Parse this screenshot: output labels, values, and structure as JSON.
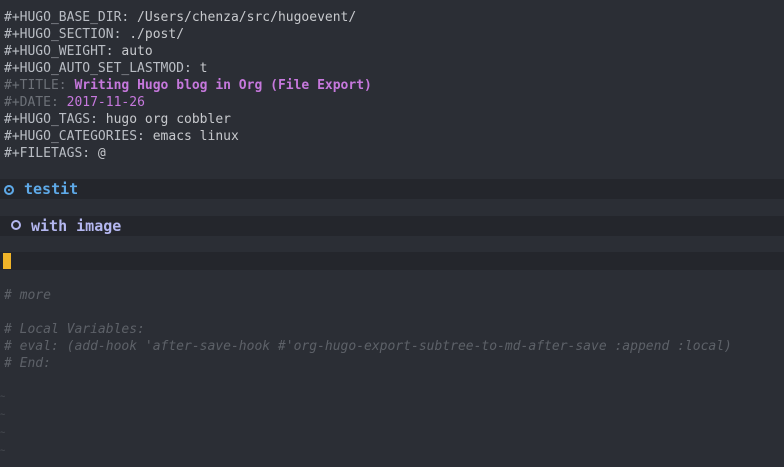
{
  "keywords": [
    {
      "key": "#+HUGO_BASE_DIR:",
      "value": " /Users/chenza/src/hugoevent/"
    },
    {
      "key": "#+HUGO_SECTION:",
      "value": " ./post/"
    },
    {
      "key": "#+HUGO_WEIGHT:",
      "value": " auto"
    },
    {
      "key": "#+HUGO_AUTO_SET_LASTMOD:",
      "value": " t"
    },
    {
      "key": "#+TITLE:",
      "value": " Writing Hugo blog in Org (File Export)"
    },
    {
      "key": "#+DATE:",
      "value": " 2017-11-26"
    },
    {
      "key": "#+HUGO_TAGS:",
      "value": " hugo org cobbler"
    },
    {
      "key": "#+HUGO_CATEGORIES:",
      "value": " emacs linux"
    },
    {
      "key": "#+FILETAGS:",
      "value": " @"
    }
  ],
  "headings": {
    "level1": "testit",
    "level2": "with image"
  },
  "comments": [
    "# more",
    "# Local Variables:",
    "# eval: (add-hook 'after-save-hook #'org-hugo-export-subtree-to-md-after-save :append :local)",
    "# End:"
  ],
  "colors": {
    "background": "#2b2e35",
    "heading_band": "#24262c",
    "heading1": "#5ea9e8",
    "heading2": "#b4b7f0",
    "title": "#c678dd",
    "cursor": "#f0b429",
    "comment": "#5d6168"
  }
}
